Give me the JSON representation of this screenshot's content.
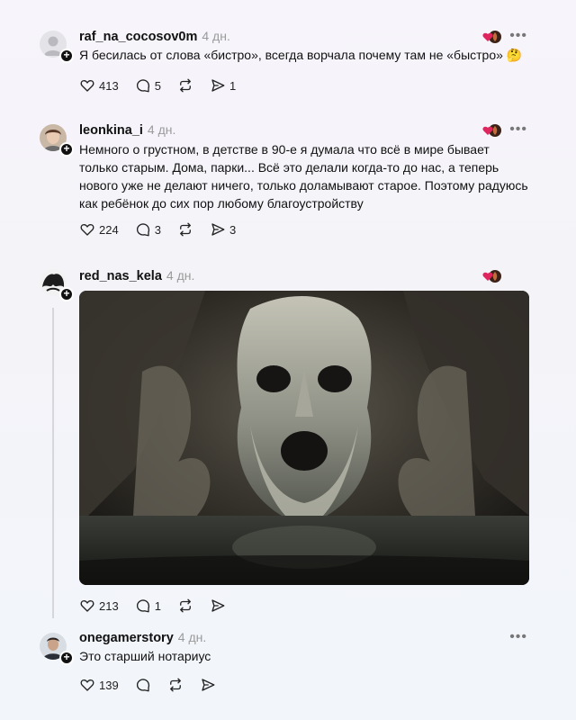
{
  "posts": [
    {
      "username": "raf_na_cocosov0m",
      "time": "4 дн.",
      "text": "Я бесилась от слова «бистро», всегда ворчала почему там не «быстро» 🤔",
      "likes": "413",
      "comments": "5",
      "shares": "1"
    },
    {
      "username": "leonkina_i",
      "time": "4 дн.",
      "text": "Немного о грустном, в детстве в 90-е я думала что всё в мире бывает только старым. Дома, парки... Всё это делали когда-то до нас, а теперь нового уже не делают ничего, только доламывают старое. Поэтому радуюсь как ребёнок до сих пор любому благоустройству",
      "likes": "224",
      "comments": "3",
      "shares": "3"
    },
    {
      "username": "red_nas_kela",
      "time": "4 дн.",
      "likes": "213",
      "comments": "1",
      "shares": ""
    },
    {
      "username": "onegamerstory",
      "time": "4 дн.",
      "text": "Это старший нотариус",
      "likes": "139",
      "comments": "",
      "shares": ""
    }
  ],
  "icons": {
    "more": "more-icon",
    "like": "heart-icon",
    "comment": "comment-icon",
    "repost": "repost-icon",
    "share": "share-icon",
    "follow": "plus-icon"
  },
  "colors": {
    "time": "#9a9a9a",
    "thread_line": "#d7d7db"
  }
}
